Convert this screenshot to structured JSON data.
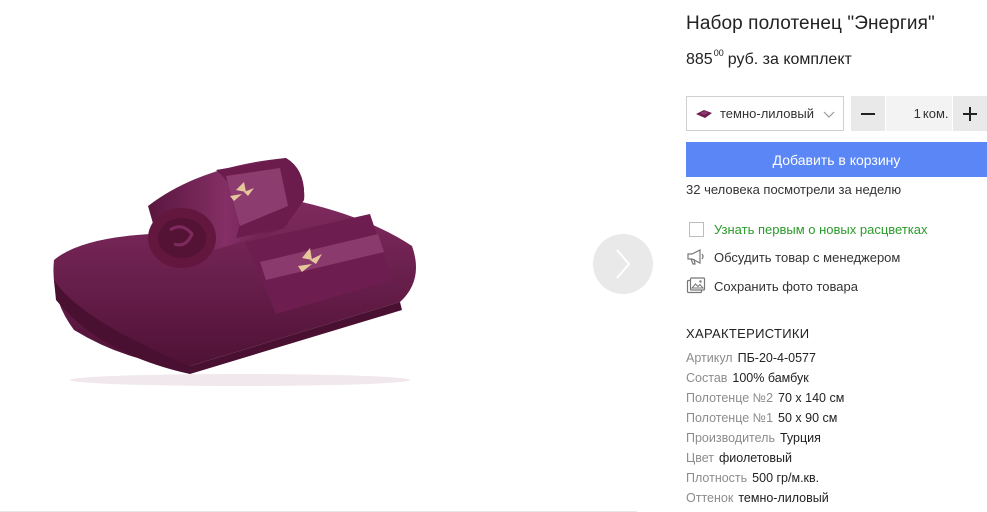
{
  "product": {
    "title": "Набор полотенец \"Энергия\"",
    "price": {
      "main": "885",
      "cents": "00",
      "suffix": "руб. за комплект"
    }
  },
  "colors": {
    "accent": "#5b86f5",
    "towel": "#6e1f4f",
    "link_green": "#2a9b2a"
  },
  "color_select": {
    "selected": "темно-лиловый",
    "icon": "chevron-down-icon"
  },
  "quantity": {
    "value": "1",
    "unit": "ком.",
    "minus": "−",
    "plus": "+"
  },
  "cart": {
    "button_label": "Добавить в корзину",
    "views_text": "32 человека посмотрели за неделю"
  },
  "actions": {
    "notify": "Узнать первым о новых расцветках",
    "discuss": "Обсудить товар с менеджером",
    "save_photo": "Сохранить фото товара"
  },
  "specs": {
    "title": "ХАРАКТЕРИСТИКИ",
    "items": [
      {
        "key": "Артикул",
        "value": "ПБ-20-4-0577"
      },
      {
        "key": "Состав",
        "value": "100% бамбук"
      },
      {
        "key": "Полотенце №2",
        "value": "70 х 140 см"
      },
      {
        "key": "Полотенце №1",
        "value": "50 х 90 см"
      },
      {
        "key": "Производитель",
        "value": "Турция"
      },
      {
        "key": "Цвет",
        "value": "фиолетовый"
      },
      {
        "key": "Плотность",
        "value": "500 гр/м.кв."
      },
      {
        "key": "Оттенок",
        "value": "темно-лиловый"
      }
    ]
  }
}
